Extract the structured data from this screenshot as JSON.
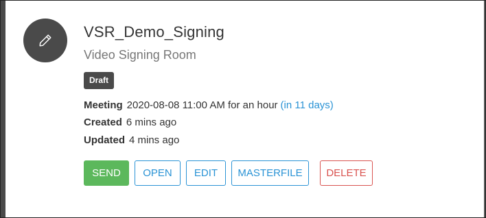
{
  "item": {
    "title": "VSR_Demo_Signing",
    "subtitle": "Video Signing Room",
    "status_badge": "Draft",
    "avatar_icon": "pencil-icon"
  },
  "meta": {
    "meeting": {
      "label": "Meeting",
      "value": "2020-08-08 11:00 AM for an hour",
      "relative": "(in 11 days)"
    },
    "created": {
      "label": "Created",
      "value": "6 mins ago"
    },
    "updated": {
      "label": "Updated",
      "value": "4 mins ago"
    }
  },
  "actions": {
    "send": "SEND",
    "open": "OPEN",
    "edit": "EDIT",
    "masterfile": "MASTERFILE",
    "delete": "DELETE"
  },
  "colors": {
    "success": "#5cb85c",
    "primary": "#2a93d5",
    "danger": "#d9534f",
    "dark": "#4a4a4a"
  }
}
